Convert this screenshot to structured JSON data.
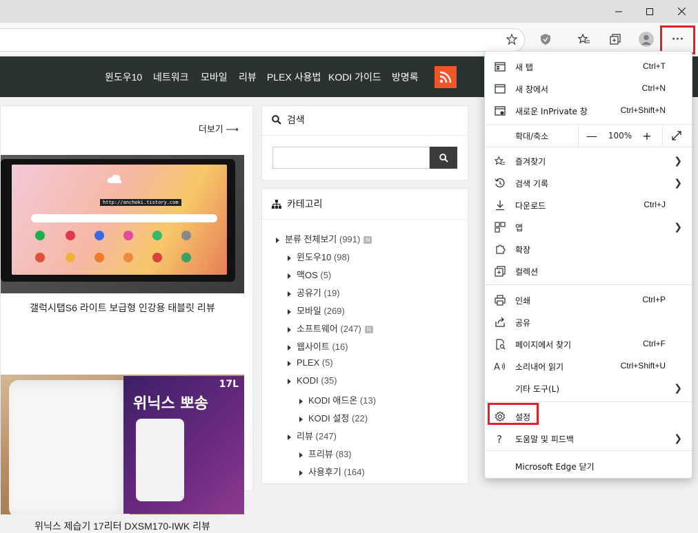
{
  "browser": {
    "window_controls": [
      "minimize-icon",
      "maximize-icon",
      "close-icon"
    ],
    "toolbar_icons": [
      "star-icon",
      "shield-icon",
      "favorites-icon",
      "collections-icon",
      "profile-icon",
      "more-icon"
    ],
    "more_label": "···"
  },
  "site_nav": {
    "items": [
      "윈도우10",
      "네트워크",
      "모바일",
      "리뷰",
      "PLEX 사용법",
      "KODI 가이드",
      "방명록"
    ]
  },
  "left": {
    "more_label": "더보기 ⟶",
    "caption1": "갤럭시탭S6 라이트 보급형 인강용 태블릿 리뷰",
    "caption2": "위닉스 제습기 17리터 DXSM170-IWK 리뷰",
    "tablet_url": "http://anchoki.tistory.com",
    "box_text": "위닉스 뽀송",
    "box_small": "17L"
  },
  "search_widget": {
    "title": "검색",
    "placeholder": ""
  },
  "category_widget": {
    "title": "카테고리",
    "items": [
      {
        "label": "분류 전체보기",
        "count": "(991)",
        "new": true,
        "level": 0
      },
      {
        "label": "윈도우10",
        "count": "(98)",
        "new": false,
        "level": 1
      },
      {
        "label": "맥OS",
        "count": "(5)",
        "new": false,
        "level": 1
      },
      {
        "label": "공유기",
        "count": "(19)",
        "new": false,
        "level": 1
      },
      {
        "label": "모바일",
        "count": "(269)",
        "new": false,
        "level": 1
      },
      {
        "label": "소프트웨어",
        "count": "(247)",
        "new": true,
        "level": 1
      },
      {
        "label": "웹사이트",
        "count": "(16)",
        "new": false,
        "level": 1
      },
      {
        "label": "PLEX",
        "count": "(5)",
        "new": false,
        "level": 1
      },
      {
        "label": "KODI",
        "count": "(35)",
        "new": false,
        "level": 1
      },
      {
        "label": "KODI 애드온",
        "count": "(13)",
        "new": false,
        "level": 2
      },
      {
        "label": "KODI 설정",
        "count": "(22)",
        "new": false,
        "level": 2
      },
      {
        "label": "리뷰",
        "count": "(247)",
        "new": false,
        "level": 1
      },
      {
        "label": "프리뷰",
        "count": "(83)",
        "new": false,
        "level": 2
      },
      {
        "label": "사용후기",
        "count": "(164)",
        "new": false,
        "level": 2
      }
    ]
  },
  "menu": {
    "items": [
      {
        "label": "새 탭",
        "shortcut": "Ctrl+T",
        "icon": "new-tab-icon",
        "chev": false
      },
      {
        "label": "새 창에서",
        "shortcut": "Ctrl+N",
        "icon": "new-window-icon",
        "chev": false
      },
      {
        "label": "새로운 InPrivate 창",
        "shortcut": "Ctrl+Shift+N",
        "icon": "inprivate-icon",
        "chev": false
      },
      {
        "label": "즐겨찾기",
        "shortcut": "",
        "icon": "favorites-icon",
        "chev": true
      },
      {
        "label": "검색 기록",
        "shortcut": "",
        "icon": "history-icon",
        "chev": true
      },
      {
        "label": "다운로드",
        "shortcut": "Ctrl+J",
        "icon": "download-icon",
        "chev": false
      },
      {
        "label": "앱",
        "shortcut": "",
        "icon": "apps-icon",
        "chev": true
      },
      {
        "label": "확장",
        "shortcut": "",
        "icon": "extensions-icon",
        "chev": false
      },
      {
        "label": "컬렉션",
        "shortcut": "",
        "icon": "collections-icon",
        "chev": false
      },
      {
        "label": "인쇄",
        "shortcut": "Ctrl+P",
        "icon": "print-icon",
        "chev": false
      },
      {
        "label": "공유",
        "shortcut": "",
        "icon": "share-icon",
        "chev": false
      },
      {
        "label": "페이지에서 찾기",
        "shortcut": "Ctrl+F",
        "icon": "find-icon",
        "chev": false
      },
      {
        "label": "소리내어 읽기",
        "shortcut": "Ctrl+Shift+U",
        "icon": "read-aloud-icon",
        "chev": false
      },
      {
        "label": "기타 도구(L)",
        "shortcut": "",
        "icon": "",
        "chev": true
      },
      {
        "label": "설정",
        "shortcut": "",
        "icon": "settings-icon",
        "chev": false
      },
      {
        "label": "도움말 및 피드백",
        "shortcut": "",
        "icon": "help-icon",
        "chev": true
      },
      {
        "label": "Microsoft Edge 닫기",
        "shortcut": "",
        "icon": "",
        "chev": false
      }
    ],
    "zoom": {
      "label": "확대/축소",
      "value": "100%",
      "minus": "—",
      "plus": "+"
    }
  },
  "colors": {
    "highlight": "#e0202a",
    "nav_bg": "#2b3332",
    "rss": "#f0552a"
  }
}
